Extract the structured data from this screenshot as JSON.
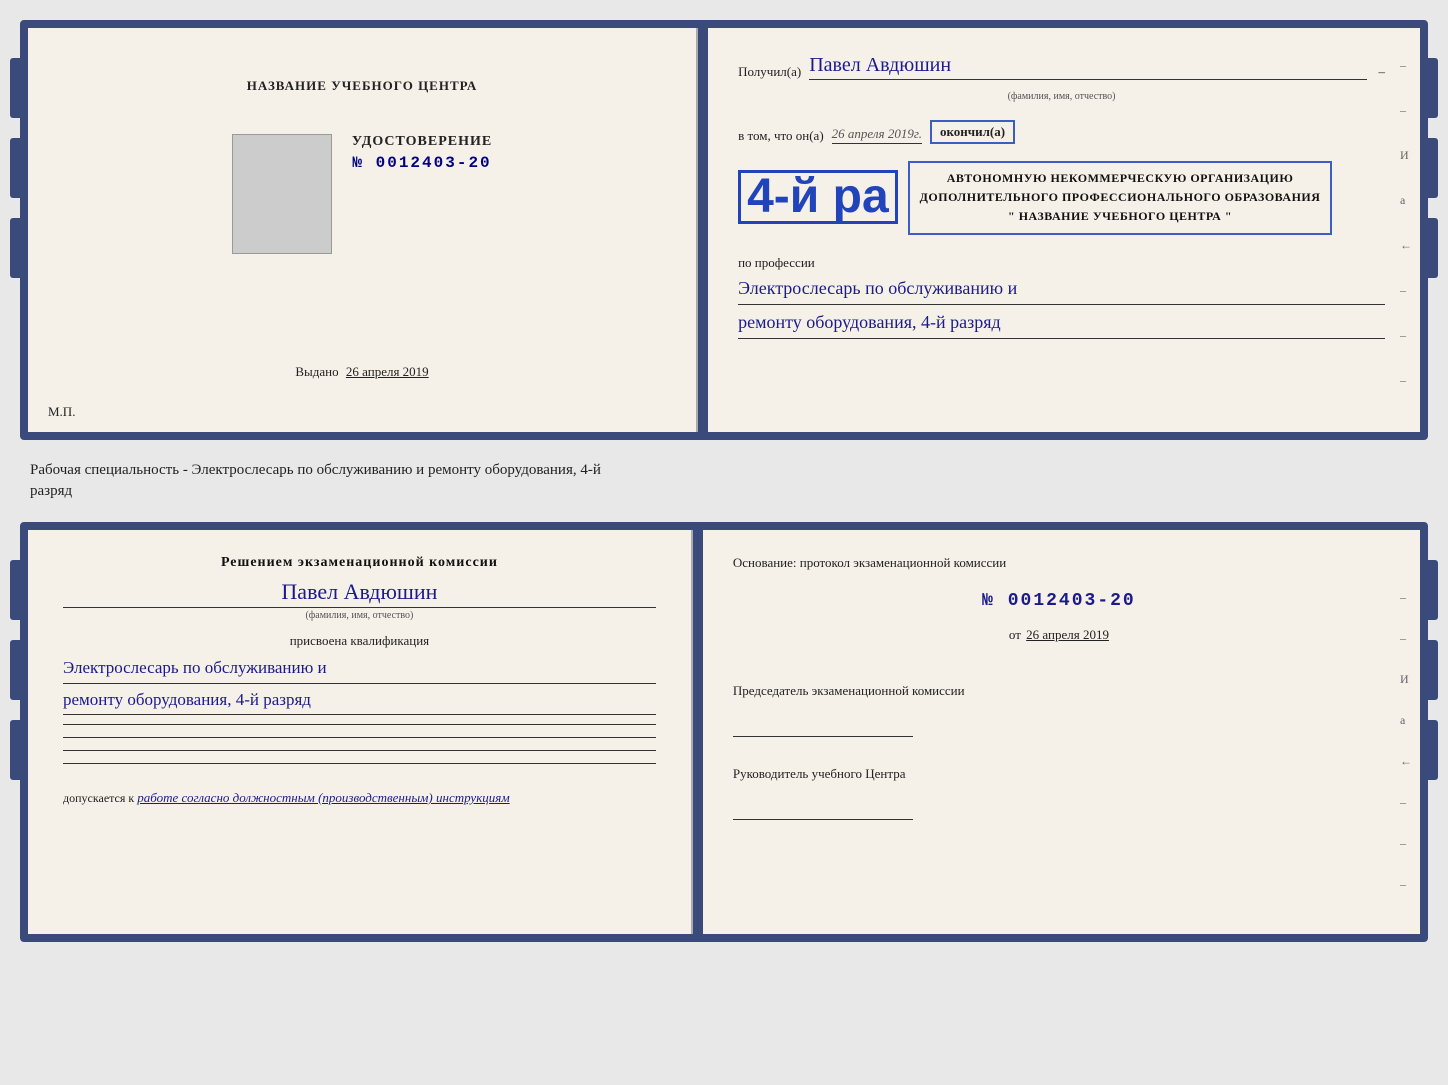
{
  "top_doc": {
    "left_panel": {
      "center_title": "НАЗВАНИЕ УЧЕБНОГО ЦЕНТРА",
      "cert_label": "УДОСТОВЕРЕНИЕ",
      "cert_number": "№ 0012403-20",
      "issued_prefix": "Выдано",
      "issued_date": "26 апреля 2019",
      "mp_label": "М.П."
    },
    "right_panel": {
      "recipient_prefix": "Получил(а)",
      "recipient_name": "Павел Авдюшин",
      "recipient_subtitle": "(фамилия, имя, отчество)",
      "vtom_prefix": "в том, что он(а)",
      "vtom_date": "26 апреля 2019г.",
      "okonchil": "окончил(а)",
      "grade_label": "4-й ра",
      "org_line1": "АВТОНОМНУЮ НЕКОММЕРЧЕСКУЮ ОРГАНИЗАЦИЮ",
      "org_line2": "ДОПОЛНИТЕЛЬНОГО ПРОФЕССИОНАЛЬНОГО ОБРАЗОВАНИЯ",
      "org_line3": "\" НАЗВАНИЕ УЧЕБНОГО ЦЕНТРА \"",
      "profession_label": "по профессии",
      "profession_hw_line1": "Электрослесарь по обслуживанию и",
      "profession_hw_line2": "ремонту оборудования, 4-й разряд"
    }
  },
  "between_text": {
    "line1": "Рабочая специальность - Электрослесарь по обслуживанию и ремонту оборудования, 4-й",
    "line2": "разряд"
  },
  "bottom_doc": {
    "left_panel": {
      "decision_title": "Решением экзаменационной комиссии",
      "person_name": "Павел Авдюшин",
      "person_subtitle": "(фамилия, имя, отчество)",
      "assigned_label": "присвоена квалификация",
      "profession_hw_line1": "Электрослесарь по обслуживанию и",
      "profession_hw_line2": "ремонту оборудования, 4-й разряд",
      "допускается_prefix": "допускается к",
      "допускается_hw": "работе согласно должностным (производственным) инструкциям"
    },
    "right_panel": {
      "osnование_text": "Основание: протокол экзаменационной  комиссии",
      "protocol_number": "№  0012403-20",
      "ot_prefix": "от",
      "ot_date": "26 апреля 2019",
      "chairman_label": "Председатель экзаменационной комиссии",
      "director_label": "Руководитель учебного Центра"
    }
  },
  "right_margin_labels": [
    "–",
    "–",
    "И",
    "а",
    "←",
    "–",
    "–",
    "–"
  ]
}
